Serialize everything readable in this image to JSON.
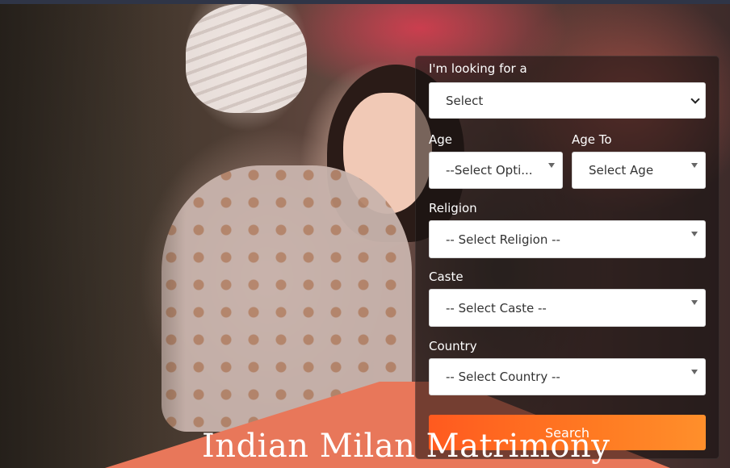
{
  "form": {
    "looking_for": {
      "label": "I'm looking for a",
      "value": "Select"
    },
    "age": {
      "label": "Age",
      "value": "--Select Opti..."
    },
    "age_to": {
      "label": "Age To",
      "value": "Select Age"
    },
    "religion": {
      "label": "Religion",
      "value": "-- Select Religion --"
    },
    "caste": {
      "label": "Caste",
      "value": "-- Select Caste --"
    },
    "country": {
      "label": "Country",
      "value": "-- Select Country --"
    },
    "search_label": "Search"
  },
  "banner": {
    "title": "Indian Milan Matrimony"
  },
  "colors": {
    "accent": "#ff6a20",
    "banner": "#e8775a",
    "panel": "#1a1414"
  },
  "icons": {
    "select_arrow": "chevron-down-icon",
    "dropdown_arrow": "caret-down-icon"
  }
}
